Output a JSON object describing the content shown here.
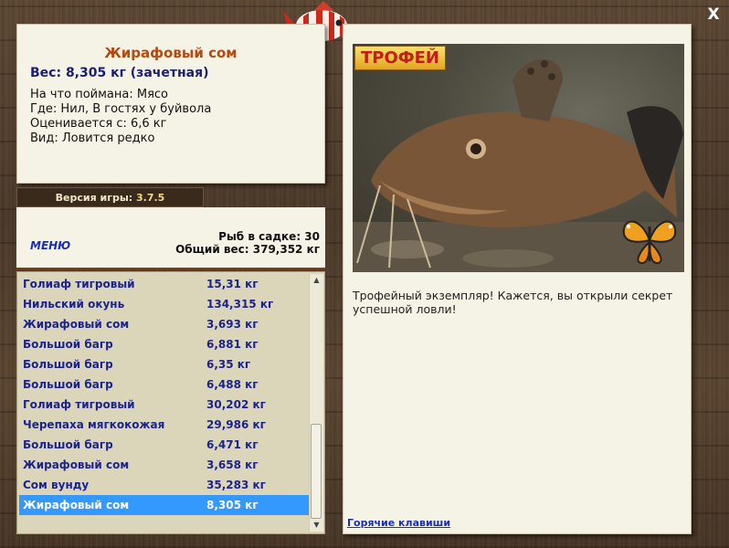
{
  "fish": {
    "title": "Жирафовый сом",
    "weight_line": "Вес: 8,305 кг (зачетная)",
    "details": [
      "На что поймана: Мясо",
      "Где: Нил, В гостях у буйвола",
      "Оценивается с: 6,6 кг",
      "Вид: Ловится редко"
    ]
  },
  "version": {
    "label": "Версия игры:",
    "value": "3.7.5"
  },
  "menu": {
    "label": "МЕНЮ"
  },
  "stats": {
    "fish_in_cage": "Рыб в садке: 30",
    "total_weight": "Общий вес: 379,352 кг"
  },
  "catch_list": [
    {
      "name": "Голиаф тигровый",
      "weight": "15,31 кг"
    },
    {
      "name": "Нильский окунь",
      "weight": "134,315 кг"
    },
    {
      "name": "Жирафовый сом",
      "weight": "3,693 кг"
    },
    {
      "name": "Большой багр",
      "weight": "6,881 кг"
    },
    {
      "name": "Большой багр",
      "weight": "6,35 кг"
    },
    {
      "name": "Большой багр",
      "weight": "6,488 кг"
    },
    {
      "name": "Голиаф тигровый",
      "weight": "30,202 кг"
    },
    {
      "name": "Черепаха мягкокожая",
      "weight": "29,986 кг"
    },
    {
      "name": "Большой багр",
      "weight": "6,471 кг"
    },
    {
      "name": "Жирафовый сом",
      "weight": "3,658 кг"
    },
    {
      "name": "Сом вунду",
      "weight": "35,283 кг"
    },
    {
      "name": "Жирафовый сом",
      "weight": "8,305 кг"
    }
  ],
  "selected_index": 11,
  "trophy": {
    "badge": "ТРОФЕЙ",
    "text": "Трофейный экземпляр! Кажется, вы открыли секрет успешной ловли!",
    "hotkeys": "Горячие клавиши"
  },
  "close": "X",
  "colors": {
    "accent": "#b24a12",
    "list_text": "#1d238e",
    "selection": "#3399ff",
    "link": "#1a2fb0"
  },
  "icons": [
    "striped-fish-logo-icon",
    "close-icon",
    "scroll-up-icon",
    "scroll-down-icon",
    "butterfly-icon"
  ]
}
